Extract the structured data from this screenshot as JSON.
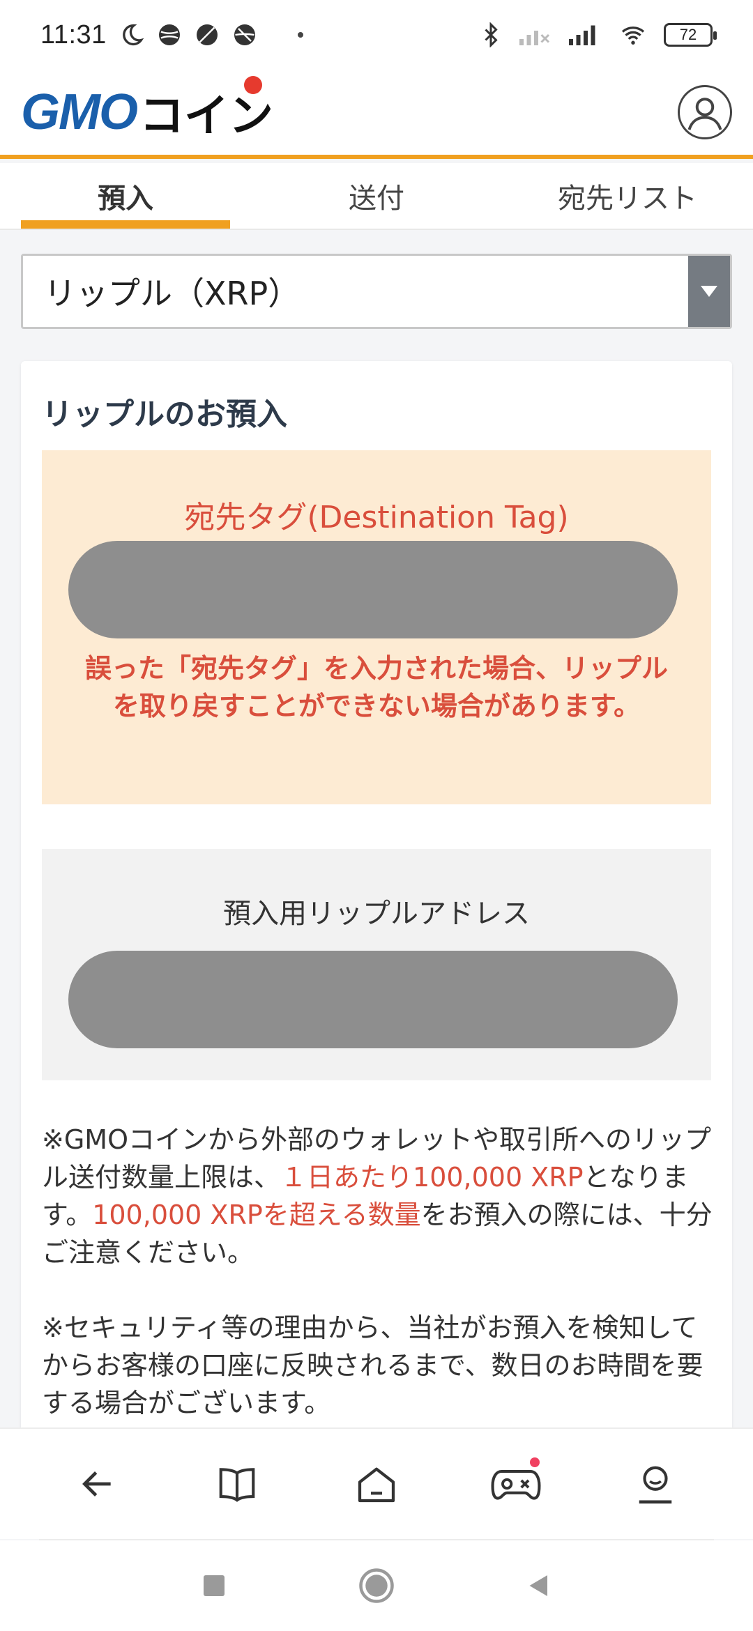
{
  "status_bar": {
    "time": "11:31",
    "battery": "72"
  },
  "header": {
    "logo_main": "GMO",
    "logo_suffix": "コイン"
  },
  "tabs": [
    {
      "label": "預入",
      "active": true
    },
    {
      "label": "送付",
      "active": false
    },
    {
      "label": "宛先リスト",
      "active": false
    }
  ],
  "currency_select": {
    "value": "リップル（XRP）"
  },
  "card": {
    "title": "リップルのお預入",
    "destination_tag": {
      "title": "宛先タグ(Destination Tag)",
      "warning": "誤った「宛先タグ」を入力された場合、リップルを取り戻すことができない場合があります。"
    },
    "address": {
      "title": "預入用リップルアドレス"
    },
    "notes": {
      "note1_a": "※GMOコインから外部のウォレットや取引所へのリップル送付数量上限は、",
      "note1_hl1": "１日あたり100,000 XRP",
      "note1_b": "となります。",
      "note1_hl2": "100,000 XRPを超える数量",
      "note1_c": "をお預入の際には、十分ご注意ください。",
      "note2": "※セキュリティ等の理由から、当社がお預入を検知してからお客様の口座に反映されるまで、数日のお時間を要する場合がございます。"
    }
  },
  "colors": {
    "accent": "#f0a020",
    "brand_blue": "#1a5fab",
    "warning_red": "#d94e3c",
    "tag_bg": "#fdebd3"
  }
}
